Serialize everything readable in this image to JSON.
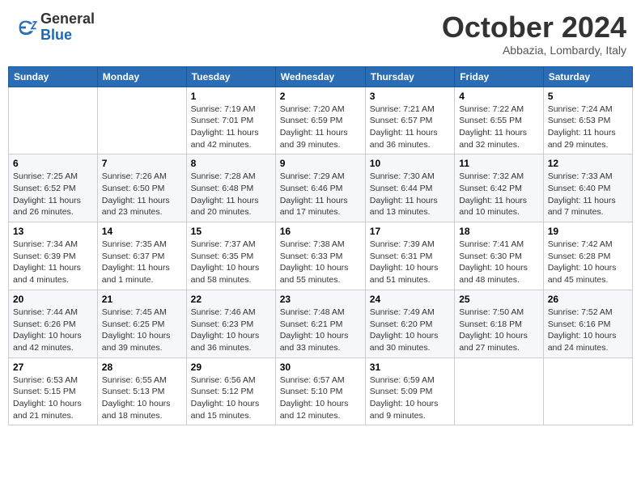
{
  "header": {
    "logo_general": "General",
    "logo_blue": "Blue",
    "month_title": "October 2024",
    "location": "Abbazia, Lombardy, Italy"
  },
  "columns": [
    "Sunday",
    "Monday",
    "Tuesday",
    "Wednesday",
    "Thursday",
    "Friday",
    "Saturday"
  ],
  "weeks": [
    [
      {
        "day": "",
        "info": ""
      },
      {
        "day": "",
        "info": ""
      },
      {
        "day": "1",
        "info": "Sunrise: 7:19 AM\nSunset: 7:01 PM\nDaylight: 11 hours and 42 minutes."
      },
      {
        "day": "2",
        "info": "Sunrise: 7:20 AM\nSunset: 6:59 PM\nDaylight: 11 hours and 39 minutes."
      },
      {
        "day": "3",
        "info": "Sunrise: 7:21 AM\nSunset: 6:57 PM\nDaylight: 11 hours and 36 minutes."
      },
      {
        "day": "4",
        "info": "Sunrise: 7:22 AM\nSunset: 6:55 PM\nDaylight: 11 hours and 32 minutes."
      },
      {
        "day": "5",
        "info": "Sunrise: 7:24 AM\nSunset: 6:53 PM\nDaylight: 11 hours and 29 minutes."
      }
    ],
    [
      {
        "day": "6",
        "info": "Sunrise: 7:25 AM\nSunset: 6:52 PM\nDaylight: 11 hours and 26 minutes."
      },
      {
        "day": "7",
        "info": "Sunrise: 7:26 AM\nSunset: 6:50 PM\nDaylight: 11 hours and 23 minutes."
      },
      {
        "day": "8",
        "info": "Sunrise: 7:28 AM\nSunset: 6:48 PM\nDaylight: 11 hours and 20 minutes."
      },
      {
        "day": "9",
        "info": "Sunrise: 7:29 AM\nSunset: 6:46 PM\nDaylight: 11 hours and 17 minutes."
      },
      {
        "day": "10",
        "info": "Sunrise: 7:30 AM\nSunset: 6:44 PM\nDaylight: 11 hours and 13 minutes."
      },
      {
        "day": "11",
        "info": "Sunrise: 7:32 AM\nSunset: 6:42 PM\nDaylight: 11 hours and 10 minutes."
      },
      {
        "day": "12",
        "info": "Sunrise: 7:33 AM\nSunset: 6:40 PM\nDaylight: 11 hours and 7 minutes."
      }
    ],
    [
      {
        "day": "13",
        "info": "Sunrise: 7:34 AM\nSunset: 6:39 PM\nDaylight: 11 hours and 4 minutes."
      },
      {
        "day": "14",
        "info": "Sunrise: 7:35 AM\nSunset: 6:37 PM\nDaylight: 11 hours and 1 minute."
      },
      {
        "day": "15",
        "info": "Sunrise: 7:37 AM\nSunset: 6:35 PM\nDaylight: 10 hours and 58 minutes."
      },
      {
        "day": "16",
        "info": "Sunrise: 7:38 AM\nSunset: 6:33 PM\nDaylight: 10 hours and 55 minutes."
      },
      {
        "day": "17",
        "info": "Sunrise: 7:39 AM\nSunset: 6:31 PM\nDaylight: 10 hours and 51 minutes."
      },
      {
        "day": "18",
        "info": "Sunrise: 7:41 AM\nSunset: 6:30 PM\nDaylight: 10 hours and 48 minutes."
      },
      {
        "day": "19",
        "info": "Sunrise: 7:42 AM\nSunset: 6:28 PM\nDaylight: 10 hours and 45 minutes."
      }
    ],
    [
      {
        "day": "20",
        "info": "Sunrise: 7:44 AM\nSunset: 6:26 PM\nDaylight: 10 hours and 42 minutes."
      },
      {
        "day": "21",
        "info": "Sunrise: 7:45 AM\nSunset: 6:25 PM\nDaylight: 10 hours and 39 minutes."
      },
      {
        "day": "22",
        "info": "Sunrise: 7:46 AM\nSunset: 6:23 PM\nDaylight: 10 hours and 36 minutes."
      },
      {
        "day": "23",
        "info": "Sunrise: 7:48 AM\nSunset: 6:21 PM\nDaylight: 10 hours and 33 minutes."
      },
      {
        "day": "24",
        "info": "Sunrise: 7:49 AM\nSunset: 6:20 PM\nDaylight: 10 hours and 30 minutes."
      },
      {
        "day": "25",
        "info": "Sunrise: 7:50 AM\nSunset: 6:18 PM\nDaylight: 10 hours and 27 minutes."
      },
      {
        "day": "26",
        "info": "Sunrise: 7:52 AM\nSunset: 6:16 PM\nDaylight: 10 hours and 24 minutes."
      }
    ],
    [
      {
        "day": "27",
        "info": "Sunrise: 6:53 AM\nSunset: 5:15 PM\nDaylight: 10 hours and 21 minutes."
      },
      {
        "day": "28",
        "info": "Sunrise: 6:55 AM\nSunset: 5:13 PM\nDaylight: 10 hours and 18 minutes."
      },
      {
        "day": "29",
        "info": "Sunrise: 6:56 AM\nSunset: 5:12 PM\nDaylight: 10 hours and 15 minutes."
      },
      {
        "day": "30",
        "info": "Sunrise: 6:57 AM\nSunset: 5:10 PM\nDaylight: 10 hours and 12 minutes."
      },
      {
        "day": "31",
        "info": "Sunrise: 6:59 AM\nSunset: 5:09 PM\nDaylight: 10 hours and 9 minutes."
      },
      {
        "day": "",
        "info": ""
      },
      {
        "day": "",
        "info": ""
      }
    ]
  ]
}
